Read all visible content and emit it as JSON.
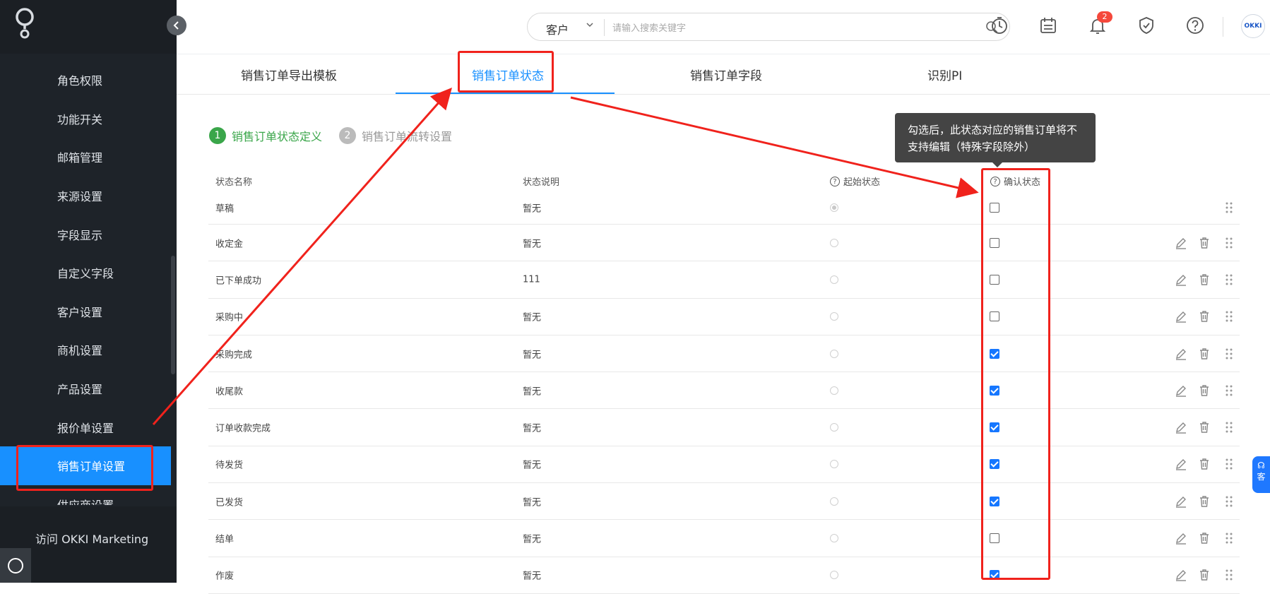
{
  "sidebar": {
    "items": [
      {
        "label": "角色权限"
      },
      {
        "label": "功能开关"
      },
      {
        "label": "邮箱管理"
      },
      {
        "label": "来源设置"
      },
      {
        "label": "字段显示"
      },
      {
        "label": "自定义字段"
      },
      {
        "label": "客户设置"
      },
      {
        "label": "商机设置"
      },
      {
        "label": "产品设置"
      },
      {
        "label": "报价单设置"
      },
      {
        "label": "销售订单设置"
      },
      {
        "label": "供应商设置"
      }
    ],
    "active_index": 10,
    "okki_link": "访问 OKKI Marketing"
  },
  "header": {
    "search_scope": "客户",
    "search_placeholder": "请输入搜索关键字",
    "notification_count": "2",
    "avatar_text": "OKKI"
  },
  "tabs": [
    {
      "label": "销售订单导出模板"
    },
    {
      "label": "销售订单状态"
    },
    {
      "label": "销售订单字段"
    },
    {
      "label": "识别PI"
    }
  ],
  "active_tab": 1,
  "steps": [
    {
      "num": "1",
      "label": "销售订单状态定义"
    },
    {
      "num": "2",
      "label": "销售订单流转设置"
    }
  ],
  "tooltip": "勾选后，此状态对应的销售订单将不支持编辑（特殊字段除外）",
  "table": {
    "columns": {
      "name": "状态名称",
      "desc": "状态说明",
      "initial": "起始状态",
      "confirm": "确认状态"
    },
    "rows": [
      {
        "name": "草稿",
        "desc": "暂无",
        "initial": true,
        "confirm": false,
        "editable": false
      },
      {
        "name": "收定金",
        "desc": "暂无",
        "initial": false,
        "confirm": false,
        "editable": true
      },
      {
        "name": "已下单成功",
        "desc": "111",
        "initial": false,
        "confirm": false,
        "editable": true
      },
      {
        "name": "采购中",
        "desc": "暂无",
        "initial": false,
        "confirm": false,
        "editable": true
      },
      {
        "name": "采购完成",
        "desc": "暂无",
        "initial": false,
        "confirm": true,
        "editable": true
      },
      {
        "name": "收尾款",
        "desc": "暂无",
        "initial": false,
        "confirm": true,
        "editable": true
      },
      {
        "name": "订单收款完成",
        "desc": "暂无",
        "initial": false,
        "confirm": true,
        "editable": true
      },
      {
        "name": "待发货",
        "desc": "暂无",
        "initial": false,
        "confirm": true,
        "editable": true
      },
      {
        "name": "已发货",
        "desc": "暂无",
        "initial": false,
        "confirm": true,
        "editable": true
      },
      {
        "name": "结单",
        "desc": "暂无",
        "initial": false,
        "confirm": false,
        "editable": true
      },
      {
        "name": "作废",
        "desc": "暂无",
        "initial": false,
        "confirm": true,
        "editable": true
      }
    ]
  },
  "help_fab_text": "客",
  "colors": {
    "primary": "#1890ff",
    "success": "#3aa64a",
    "annotation": "#f0221c",
    "sidebar_bg": "#1e2329"
  }
}
